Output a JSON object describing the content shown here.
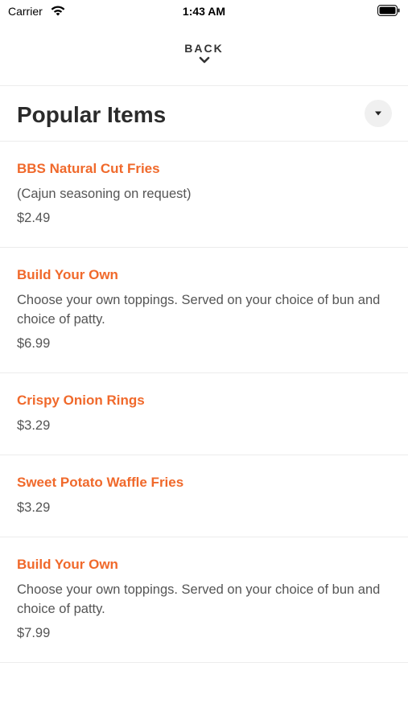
{
  "status_bar": {
    "carrier": "Carrier",
    "time": "1:43 AM"
  },
  "nav": {
    "back_label": "BACK"
  },
  "section": {
    "title": "Popular Items"
  },
  "items": [
    {
      "name": "BBS Natural Cut Fries",
      "description": "(Cajun seasoning on request)",
      "price": "$2.49"
    },
    {
      "name": "Build Your Own",
      "description": "Choose your own toppings. Served on your choice of bun and choice of patty.",
      "price": "$6.99"
    },
    {
      "name": "Crispy Onion Rings",
      "description": "",
      "price": "$3.29"
    },
    {
      "name": "Sweet Potato Waffle Fries",
      "description": "",
      "price": "$3.29"
    },
    {
      "name": "Build Your Own",
      "description": "Choose your own toppings. Served on your choice of bun and choice of patty.",
      "price": "$7.99"
    }
  ],
  "colors": {
    "accent": "#f0692b",
    "text_secondary": "#555555",
    "divider": "#ececec"
  },
  "icons": {
    "wifi": "wifi-icon",
    "battery": "battery-icon",
    "back": "chevron-down-icon",
    "dropdown": "caret-down-icon"
  }
}
